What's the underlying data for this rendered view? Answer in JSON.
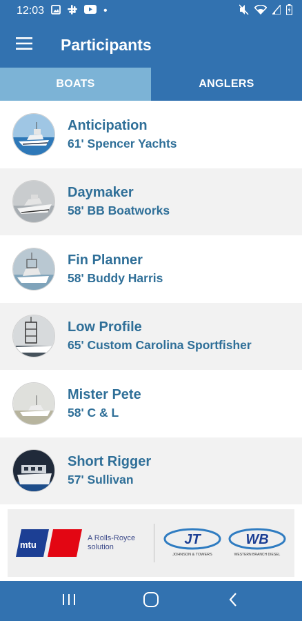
{
  "status_bar": {
    "time": "12:03",
    "dot": "•"
  },
  "app_bar": {
    "title": "Participants",
    "menu_icon": "hamburger-menu-icon"
  },
  "tabs": [
    {
      "label": "BOATS",
      "active": true
    },
    {
      "label": "ANGLERS",
      "active": false
    }
  ],
  "boats": [
    {
      "name": "Anticipation",
      "description": "61' Spencer Yachts"
    },
    {
      "name": "Daymaker",
      "description": "58' BB Boatworks"
    },
    {
      "name": "Fin Planner",
      "description": "58' Buddy Harris"
    },
    {
      "name": "Low Profile",
      "description": "65' Custom Carolina Sportfisher"
    },
    {
      "name": "Mister Pete",
      "description": "58' C & L"
    },
    {
      "name": "Short Rigger",
      "description": "57' Sullivan"
    }
  ],
  "banner": {
    "mtu": "mtu",
    "rolls_royce_line1": "A Rolls-Royce",
    "rolls_royce_line2": "solution",
    "jt": "JT",
    "jt_caption": "JOHNSON & TOWERS",
    "wb": "WB",
    "wb_caption": "WESTERN BRANCH DIESEL"
  },
  "colors": {
    "primary": "#3272b0",
    "active_tab": "#7cb3d6",
    "text_accent": "#2f6f98",
    "mtu_red": "#e30613",
    "mtu_blue": "#1c3f94"
  }
}
